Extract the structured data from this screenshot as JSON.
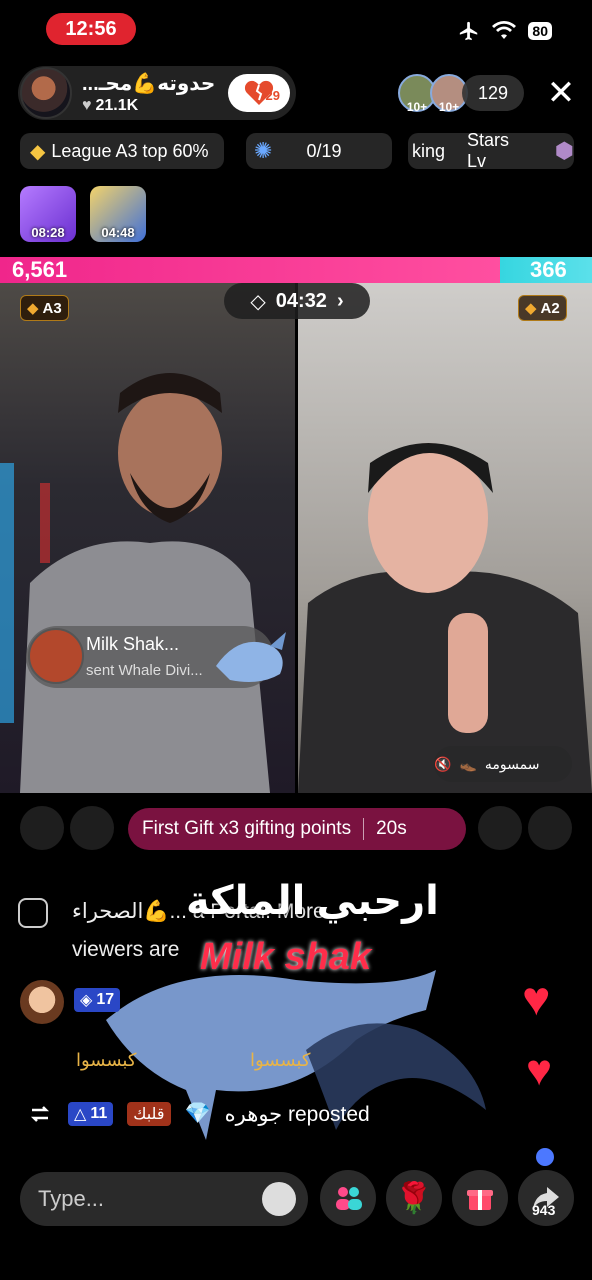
{
  "status_bar": {
    "time": "12:56",
    "battery": "80"
  },
  "host": {
    "name": "حدوته💪محـ...",
    "likes": "21.1K",
    "follow_badge": "29"
  },
  "viewers": {
    "count": "129",
    "avatar_labels": [
      "10+",
      "10+"
    ]
  },
  "chips": {
    "league": "League A3 top 60%",
    "progress": "0/19",
    "ranking_partial": "king",
    "stars": "Stars Lv"
  },
  "mini_cards": [
    "08:28",
    "04:48"
  ],
  "battle": {
    "score_left": "6,561",
    "score_right": "366",
    "timer": "04:32",
    "left_rank": "A3",
    "right_rank": "A2"
  },
  "gift_popup": {
    "name": "Milk Shak...",
    "desc": "sent Whale Divi..."
  },
  "mute_tag": "سمسومه",
  "gift_banner": {
    "text": "First Gift x3 gifting points",
    "seconds": "20s"
  },
  "chat": {
    "system_line1": "الصحراء💪... a Portal. More",
    "system_line2": "viewers are",
    "overlay_arabic": "ارحبي الملكة",
    "overlay_name": "Milk shak",
    "user_level": "17",
    "repost_level": "11",
    "repost_badge": "قلبك",
    "repost_text": "جوهره reposted",
    "gift_tags": [
      "كبسسوا",
      "كبسسوا"
    ]
  },
  "input": {
    "placeholder": "Type..."
  },
  "share_count": "943",
  "colors": {
    "pink": "#f0268b",
    "teal": "#36d6e0",
    "banner": "#7a1240",
    "badge_blue": "#2a47c6",
    "heart": "#ff2745"
  }
}
